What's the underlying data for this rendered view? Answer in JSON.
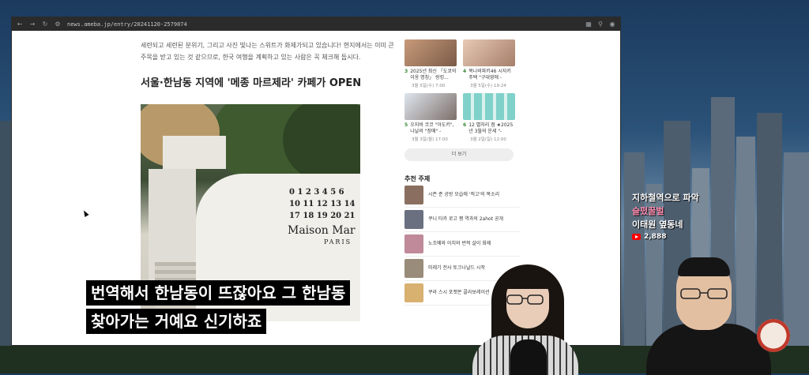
{
  "browser": {
    "url": "news.ameba.jp/entry/20241120-2579074"
  },
  "article": {
    "paragraph": "세련되고 세련된 분위기, 그리고 사진 빛나는 스위트가 화제가되고 있습니다! 현지에서는 이미 큰 주목을 받고 있는 것 같으므로, 한국 여행을 계획하고 있는 사람은 꼭 체크해 둡시다.",
    "heading": "서울·한남동 지역에 '메종 마르제라' 카페가 OPEN",
    "photo_numbers": [
      "0 1 2 3 4 5 6",
      "10 11 12 13 14",
      "17 18 19 20 21"
    ],
    "photo_brand": "Maison Mar",
    "photo_brand_sub": "PARIS"
  },
  "ranking": {
    "cards": [
      {
        "rank": "3",
        "title": "2025년 최신 「도쿄의 이옹 명칭」 랑킹...",
        "date": "3월 5일(수) 7:00"
      },
      {
        "rank": "4",
        "title": "목나비파키46 시자키 주택 \"구대영에 -",
        "date": "3월 5일(수) 19:24"
      },
      {
        "rank": "5",
        "title": "오지비 코코 \"아도키\", 나날의 \"정매\" -",
        "date": "3월 3일(월) 17:00"
      },
      {
        "rank": "6",
        "title": "12 별자리 점 ★2025년 3월의 운세 \"-",
        "date": "3월 2일(일) 12:00"
      }
    ],
    "more_label": "더 보기"
  },
  "topics": {
    "title": "추천 주제",
    "items": [
      {
        "text": "시즌 준 공방 모습에 '적고'의 목소리"
      },
      {
        "text": "쿠니 타카 로고 평 역과의 2ahot 공개"
      },
      {
        "text": "노조메와 아치와 번적 살이 화제"
      },
      {
        "text": "미레기 전사 토크나날드 시작"
      },
      {
        "text": "쿠라 스시 포켓몬 콜라보레이션"
      }
    ]
  },
  "subtitles": {
    "line1": "번역해서 한남동이 뜨잖아요 그 한남동",
    "line2": "찾아가는 거예요 신기하죠"
  },
  "channel_overlay": {
    "line1": "지하철역으로 파악",
    "line2": "슬펐꿀벌",
    "line3": "이태원 옆동네",
    "views": "2,888"
  },
  "colors": {
    "subtitle_bg": "#000000",
    "accent_pink": "#ff8db0",
    "youtube_red": "#ff0000"
  }
}
